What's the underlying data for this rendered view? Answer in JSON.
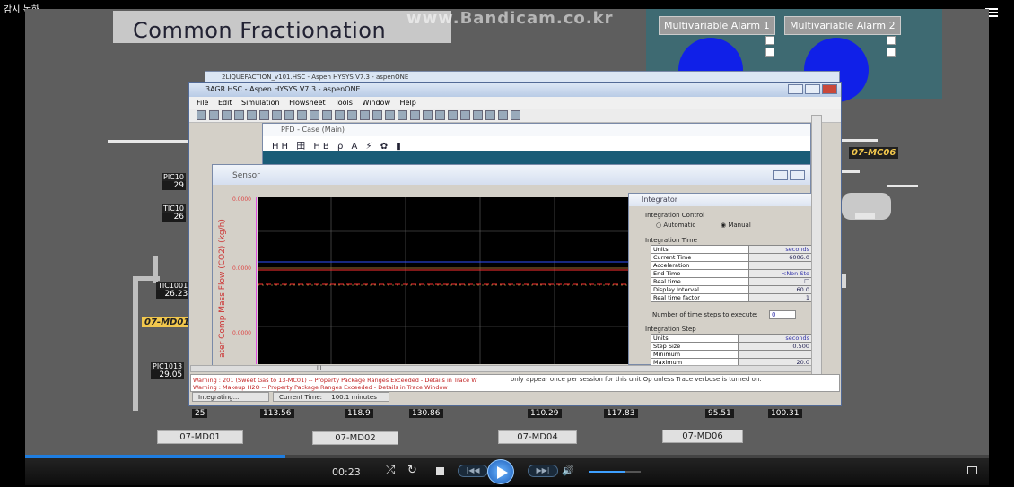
{
  "topbar": {
    "label": "감시 녹화"
  },
  "hmi": {
    "title": "Common Fractionation",
    "watermark": "www.Bandicam.co.kr",
    "alarms": [
      "Multivariable Alarm 1",
      "Multivariable Alarm 2"
    ],
    "left_tags": [
      {
        "tag": "PIC10",
        "val": "29"
      },
      {
        "tag": "TIC10",
        "val": "26"
      },
      {
        "tag": "TIC1001",
        "val": "26.23"
      },
      {
        "tag": "PIC1013",
        "val": "29.05"
      }
    ],
    "md_labels": {
      "md06_tag": "07-MC06",
      "md01_tag": "07-MD01"
    },
    "bottom_values": [
      "25",
      "113.56",
      "118.9",
      "130.86",
      "110.29",
      "117.83",
      "95.51",
      "100.31"
    ],
    "md_buttons": [
      "07-MD01",
      "07-MD02",
      "07-MD04",
      "07-MD06"
    ]
  },
  "hysys": {
    "back_title": "2LIQUEFACTION_v101.HSC - Aspen HYSYS V7.3 - aspenONE",
    "main_title": "3AGR.HSC - Aspen HYSYS V7.3 - aspenONE",
    "menu": [
      "File",
      "Edit",
      "Simulation",
      "Flowsheet",
      "Tools",
      "Window",
      "Help"
    ],
    "pfd_title": "PFD - Case (Main)",
    "pfd_tools": "HH 田 HB ρ A ⚡ ✿ ▮",
    "sensor_title": "Sensor",
    "sensor_ylabel": "ater Comp Mass Flow (CO2) (kg/h)",
    "sensor_yticks": [
      "0.0000",
      "0.0000",
      "0.0000"
    ],
    "scroll_mark": "III",
    "integrator": {
      "title": "Integrator",
      "control_group": "Integration Control",
      "automatic": "Automatic",
      "manual": "Manual",
      "time_group": "Integration Time",
      "time_rows": [
        {
          "label": "Units",
          "value": "seconds"
        },
        {
          "label": "Current Time",
          "value": "6006.0"
        },
        {
          "label": "Acceleration",
          "value": ""
        },
        {
          "label": "End Time",
          "value": "<Non Sto"
        },
        {
          "label": "Real time",
          "value": ""
        },
        {
          "label": "Display Interval",
          "value": "60.0"
        },
        {
          "label": "Real time factor",
          "value": "1"
        }
      ],
      "steps_label": "Number of time steps to execute:",
      "steps_value": "0",
      "step_group": "Integration Step",
      "step_rows": [
        {
          "label": "Units",
          "value": "seconds"
        },
        {
          "label": "Step Size",
          "value": "0.500"
        },
        {
          "label": "Minimum",
          "value": ""
        },
        {
          "label": "Maximum",
          "value": "20.0"
        }
      ]
    },
    "warnings": [
      "Warning : 201 (Sweet Gas to 13-MC01) -- Property Package Ranges Exceeded - Details in Trace W",
      "Warning : Makeup H2O -- Property Package Ranges Exceeded - Details in Trace Window"
    ],
    "trace_text": "only appear once per session for this unit Op unless Trace verbose is turned on.",
    "status": {
      "state": "Integrating...",
      "time_label": "Current Time:",
      "time_value": "100.1 minutes"
    }
  },
  "player": {
    "time": "00:23",
    "progress": 0.27,
    "volume": 0.7
  }
}
